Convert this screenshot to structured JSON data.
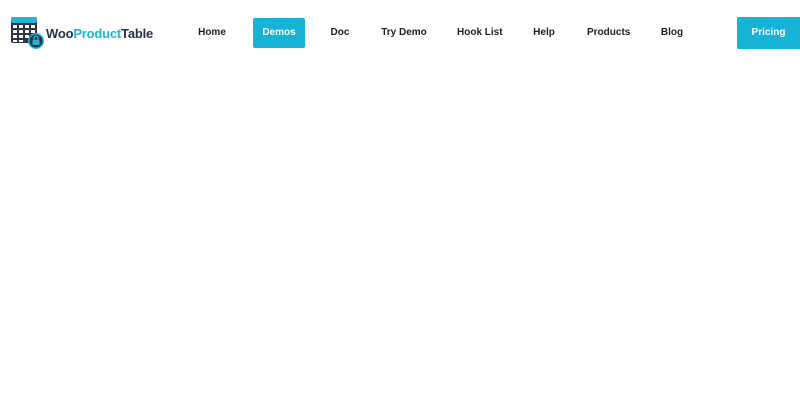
{
  "brand": {
    "logo_part1": "Woo",
    "logo_part2": "Product",
    "logo_part3": "Table",
    "logo_icon": "table-grid-lock-icon",
    "accent_color": "#16b3d7",
    "dark_color": "#25323f"
  },
  "nav": {
    "items": [
      {
        "label": "Home",
        "active": false
      },
      {
        "label": "Demos",
        "active": true
      },
      {
        "label": "Doc",
        "active": false
      },
      {
        "label": "Try Demo",
        "active": false
      },
      {
        "label": "Hook List",
        "active": false
      },
      {
        "label": "Help",
        "active": false
      },
      {
        "label": "Products",
        "active": false
      },
      {
        "label": "Blog",
        "active": false
      }
    ],
    "cta_label": "Pricing"
  }
}
